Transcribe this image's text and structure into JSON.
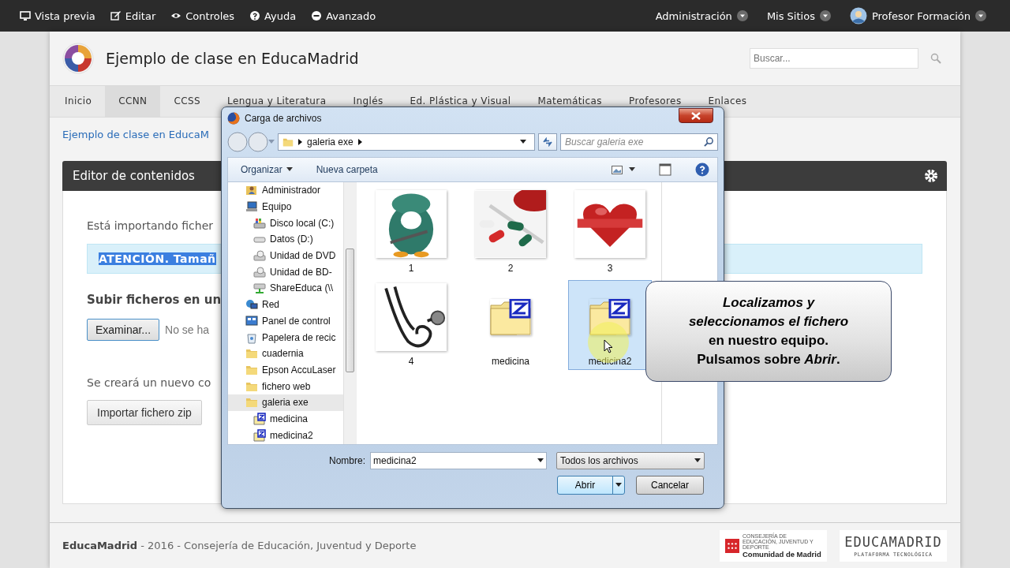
{
  "topbar": {
    "left": [
      {
        "kind": "monitor",
        "label": "Vista previa"
      },
      {
        "kind": "edit",
        "label": "Editar"
      },
      {
        "kind": "eye",
        "label": "Controles"
      },
      {
        "kind": "help",
        "label": "Ayuda"
      },
      {
        "kind": "minus",
        "label": "Avanzado"
      }
    ],
    "right": [
      {
        "kind": "menu",
        "label": "Administración"
      },
      {
        "kind": "menu",
        "label": "Mis Sitios"
      },
      {
        "kind": "user",
        "label": "Profesor Formación"
      }
    ]
  },
  "header": {
    "title": "Ejemplo de clase en EducaMadrid",
    "search_placeholder": "Buscar..."
  },
  "nav": [
    {
      "label": "Inicio",
      "selected": false
    },
    {
      "label": "CCNN",
      "selected": true
    },
    {
      "label": "CCSS",
      "selected": false
    },
    {
      "label": "Lengua y Literatura",
      "selected": false
    },
    {
      "label": "Inglés",
      "selected": false
    },
    {
      "label": "Ed. Plástica y Visual",
      "selected": false
    },
    {
      "label": "Matemáticas",
      "selected": false
    },
    {
      "label": "Profesores",
      "selected": false
    },
    {
      "label": "Enlaces",
      "selected": false
    }
  ],
  "breadcrumb": "Ejemplo de clase en EducaM",
  "panel": {
    "title": "Editor de contenidos",
    "intro": "Está importando ficher",
    "notice": "ATENCIÓN. Tamañ",
    "upload_heading": "Subir ficheros en un",
    "browse_button": "Examinar...",
    "file_status": "No se ha",
    "create_note": "Se creará un nuevo co",
    "import_button": "Importar fichero zip"
  },
  "dialog": {
    "title": "Carga de archivos",
    "path": [
      "galeria exe"
    ],
    "search_placeholder": "Buscar galeria exe",
    "toolbar": [
      {
        "kind": "menu",
        "label": "Organizar"
      },
      {
        "kind": "button",
        "label": "Nueva carpeta"
      }
    ],
    "tree": [
      {
        "kind": "user",
        "label": "Administrador",
        "selected": false
      },
      {
        "kind": "computer",
        "label": "Equipo",
        "selected": false,
        "children": [
          {
            "kind": "system-drive",
            "label": "Disco local (C:)",
            "selected": false
          },
          {
            "kind": "drive",
            "label": "Datos (D:)",
            "selected": false
          },
          {
            "kind": "optical",
            "label": "Unidad de DVD",
            "selected": false
          },
          {
            "kind": "optical",
            "label": "Unidad de BD-",
            "selected": false
          },
          {
            "kind": "network-drive",
            "label": "ShareEduca (\\\\",
            "selected": false
          }
        ]
      },
      {
        "kind": "network",
        "label": "Red",
        "selected": false
      },
      {
        "kind": "control-panel",
        "label": "Panel de control",
        "selected": false
      },
      {
        "kind": "recycle",
        "label": "Papelera de recic",
        "selected": false
      },
      {
        "kind": "folder",
        "label": "cuadernia",
        "selected": false
      },
      {
        "kind": "folder",
        "label": "Epson AccuLaser",
        "selected": false
      },
      {
        "kind": "folder",
        "label": "fichero web",
        "selected": false
      },
      {
        "kind": "folder",
        "label": "galeria exe",
        "selected": true,
        "children": [
          {
            "kind": "zip",
            "label": "medicina",
            "selected": false
          },
          {
            "kind": "zip",
            "label": "medicina2",
            "selected": false
          }
        ]
      }
    ],
    "files": [
      {
        "kind": "picture",
        "label": "1",
        "selected": false
      },
      {
        "kind": "picture",
        "label": "2",
        "selected": false
      },
      {
        "kind": "picture",
        "label": "3",
        "selected": false
      },
      {
        "kind": "picture",
        "label": "4",
        "selected": false
      },
      {
        "kind": "zip",
        "label": "medicina",
        "selected": false
      },
      {
        "kind": "zip",
        "label": "medicina2",
        "selected": true
      }
    ],
    "name_label": "Nombre:",
    "name_value": "medicina2",
    "filter": "Todos los archivos",
    "open_button": "Abrir",
    "cancel_button": "Cancelar"
  },
  "callout": {
    "lines": [
      "*Localizamos  y*",
      "*seleccionamos el fichero*",
      "en nuestro equipo.",
      "Pulsamos sobre *Abrir*."
    ]
  },
  "footer": {
    "text": "**EducaMadrid** - 2016 - Consejería de Educación, Juventud y Deporte",
    "region_small": "CONSEJERÍA DE EDUCACIÓN, JUVENTUD Y DEPORTE",
    "region_name": "Comunidad de Madrid",
    "brand": "EDUCAMADRID",
    "brand_sub": "PLATAFORMA TECNOLÓGICA"
  }
}
